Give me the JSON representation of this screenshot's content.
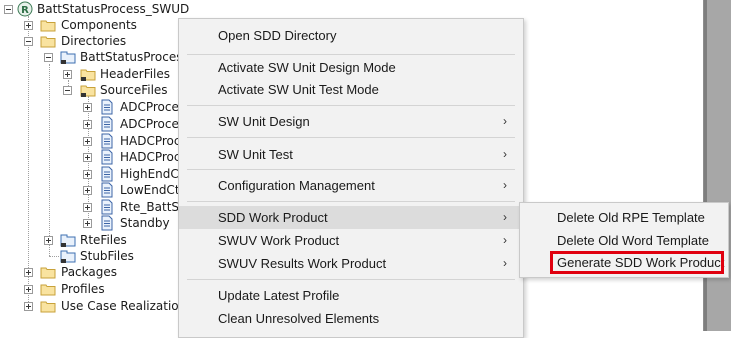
{
  "tree": {
    "root": "BattStatusProcess_SWUD",
    "nodes": {
      "components": "Components",
      "directories": "Directories",
      "package": "BattStatusProcess_",
      "headerfiles": "HeaderFiles",
      "sourcefiles": "SourceFiles",
      "files": [
        "ADCProces",
        "ADCProces",
        "HADCProc",
        "HADCProc",
        "HighEndCt",
        "LowEndCtr",
        "Rte_BattSta",
        "Standby"
      ],
      "rtefiles": "RteFiles",
      "stubfiles": "StubFiles",
      "packages": "Packages",
      "profiles": "Profiles",
      "usecases": "Use Case Realizations"
    }
  },
  "context_menu": {
    "items": [
      {
        "label": "Open SDD Directory"
      },
      {
        "label": "Activate SW Unit Design Mode"
      },
      {
        "label": "Activate SW Unit Test Mode"
      },
      {
        "label": "SW Unit Design",
        "submenu": true
      },
      {
        "label": "SW Unit Test",
        "submenu": true
      },
      {
        "label": "Configuration Management",
        "submenu": true
      },
      {
        "label": "SDD Work Product",
        "submenu": true,
        "highlighted": true
      },
      {
        "label": "SWUV Work Product",
        "submenu": true
      },
      {
        "label": "SWUV Results Work Product",
        "submenu": true
      },
      {
        "label": "Update Latest Profile"
      },
      {
        "label": "Clean Unresolved Elements"
      }
    ],
    "chevron": "›"
  },
  "submenu": {
    "items": [
      {
        "label": "Delete Old RPE Template"
      },
      {
        "label": "Delete Old Word Template"
      },
      {
        "label": "Generate SDD Work Product",
        "boxed": true
      }
    ],
    "highlight_color": "#e0000f"
  },
  "icons": {
    "root": "model-project-icon",
    "folder": "folder-icon",
    "package": "package-icon",
    "file": "document-icon"
  }
}
